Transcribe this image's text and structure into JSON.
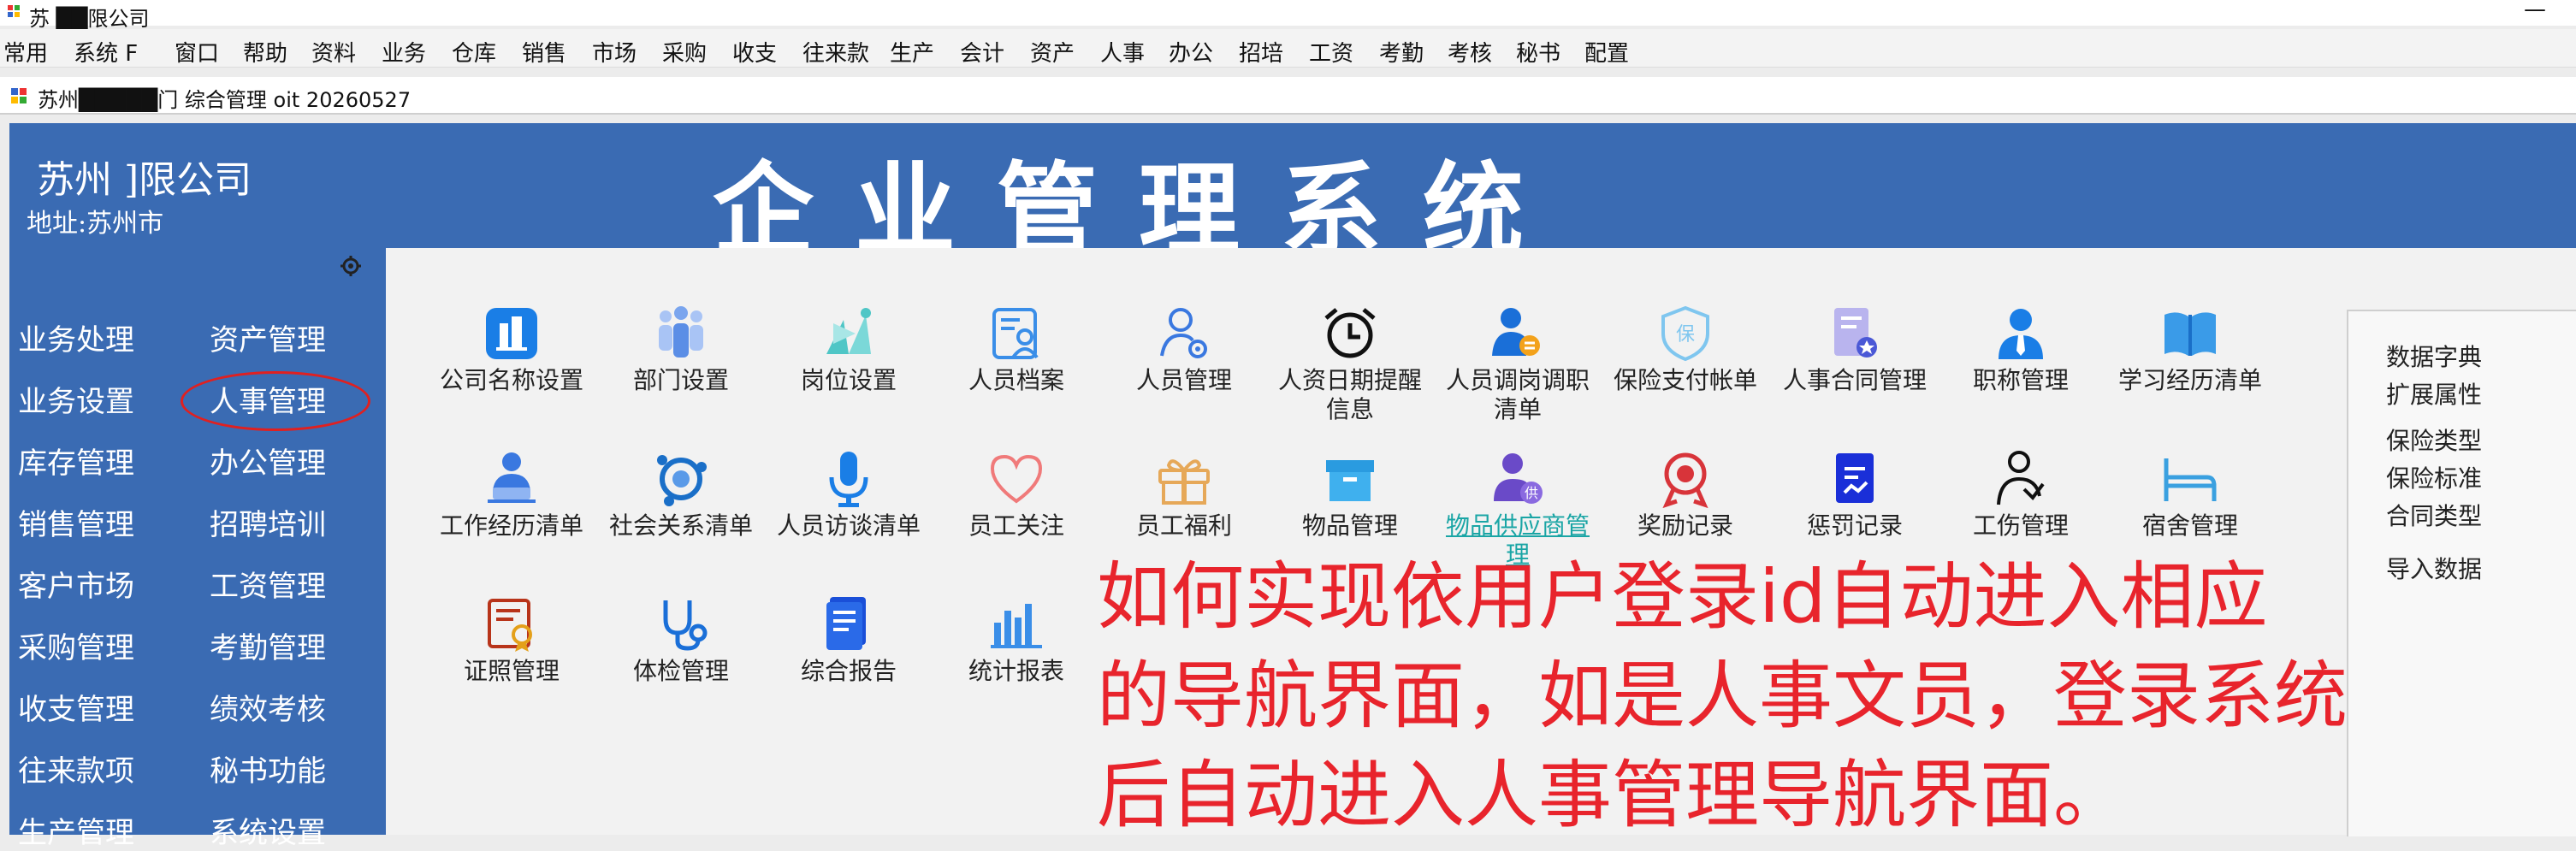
{
  "window": {
    "title": "苏        ██限公司",
    "minimize_label": "—"
  },
  "menu": [
    "常用",
    "系统 F",
    "窗口",
    "帮助",
    "资料",
    "业务",
    "仓库",
    "销售",
    "市场",
    "采购",
    "收支",
    "往来款",
    "生产",
    "会计",
    "资产",
    "人事",
    "办公",
    "招培",
    "工资",
    "考勤",
    "考核",
    "秘书",
    "配置"
  ],
  "tab": {
    "label": "苏州█████门 综合管理 oit 20260527"
  },
  "header": {
    "company": "苏州            ]限公司",
    "address": "地址:苏州市",
    "system_title": "企业管理系统"
  },
  "sidebar": {
    "left": [
      "业务处理",
      "业务设置",
      "库存管理",
      "销售管理",
      "客户市场",
      "采购管理",
      "收支管理",
      "往来款项",
      "生产管理"
    ],
    "right": [
      "资产管理",
      "人事管理",
      "办公管理",
      "招聘培训",
      "工资管理",
      "考勤管理",
      "绩效考核",
      "秘书功能",
      "系统设置"
    ]
  },
  "tiles": [
    [
      {
        "label": "公司名称设置",
        "icon": "building-icon"
      },
      {
        "label": "部门设置",
        "icon": "group-icon"
      },
      {
        "label": "岗位设置",
        "icon": "position-icon"
      },
      {
        "label": "人员档案",
        "icon": "profile-card-icon"
      },
      {
        "label": "人员管理",
        "icon": "user-gear-icon"
      },
      {
        "label": "人资日期提醒\n信息",
        "icon": "alarm-clock-icon"
      },
      {
        "label": "人员调岗调职\n清单",
        "icon": "user-transfer-icon"
      },
      {
        "label": "保险支付帐单",
        "icon": "shield-bao-icon"
      },
      {
        "label": "人事合同管理",
        "icon": "contract-icon"
      },
      {
        "label": "职称管理",
        "icon": "person-tie-icon"
      },
      {
        "label": "学习经历清单",
        "icon": "book-icon"
      }
    ],
    [
      {
        "label": "工作经历清单",
        "icon": "worker-laptop-icon"
      },
      {
        "label": "社会关系清单",
        "icon": "network-icon"
      },
      {
        "label": "人员访谈清单",
        "icon": "microphone-icon"
      },
      {
        "label": "员工关注",
        "icon": "heart-icon"
      },
      {
        "label": "员工福利",
        "icon": "gift-icon"
      },
      {
        "label": "物品管理",
        "icon": "box-icon"
      },
      {
        "label": "物品供应商管\n理",
        "icon": "supplier-icon",
        "link": true
      },
      {
        "label": "奖励记录",
        "icon": "medal-icon"
      },
      {
        "label": "惩罚记录",
        "icon": "penalty-doc-icon"
      },
      {
        "label": "工伤管理",
        "icon": "injury-icon"
      },
      {
        "label": "宿舍管理",
        "icon": "bed-icon"
      }
    ],
    [
      {
        "label": "证照管理",
        "icon": "certificate-icon"
      },
      {
        "label": "体检管理",
        "icon": "stethoscope-icon"
      },
      {
        "label": "综合报告",
        "icon": "report-icon"
      },
      {
        "label": "统计报表",
        "icon": "bar-chart-icon"
      }
    ]
  ],
  "right_panel": [
    "数据字典",
    "扩展属性",
    "保险类型",
    "保险标准",
    "合同类型",
    "导入数据"
  ],
  "overlay": {
    "lines": [
      "如何实现依用户登录id自动进入相应",
      "的导航界面，如是人事文员，登录系统",
      "后自动进入人事管理导航界面。"
    ]
  },
  "colors": {
    "header_blue": "#3a6bb3",
    "overlay_red": "#e8242c",
    "circle_red": "#e02020"
  }
}
